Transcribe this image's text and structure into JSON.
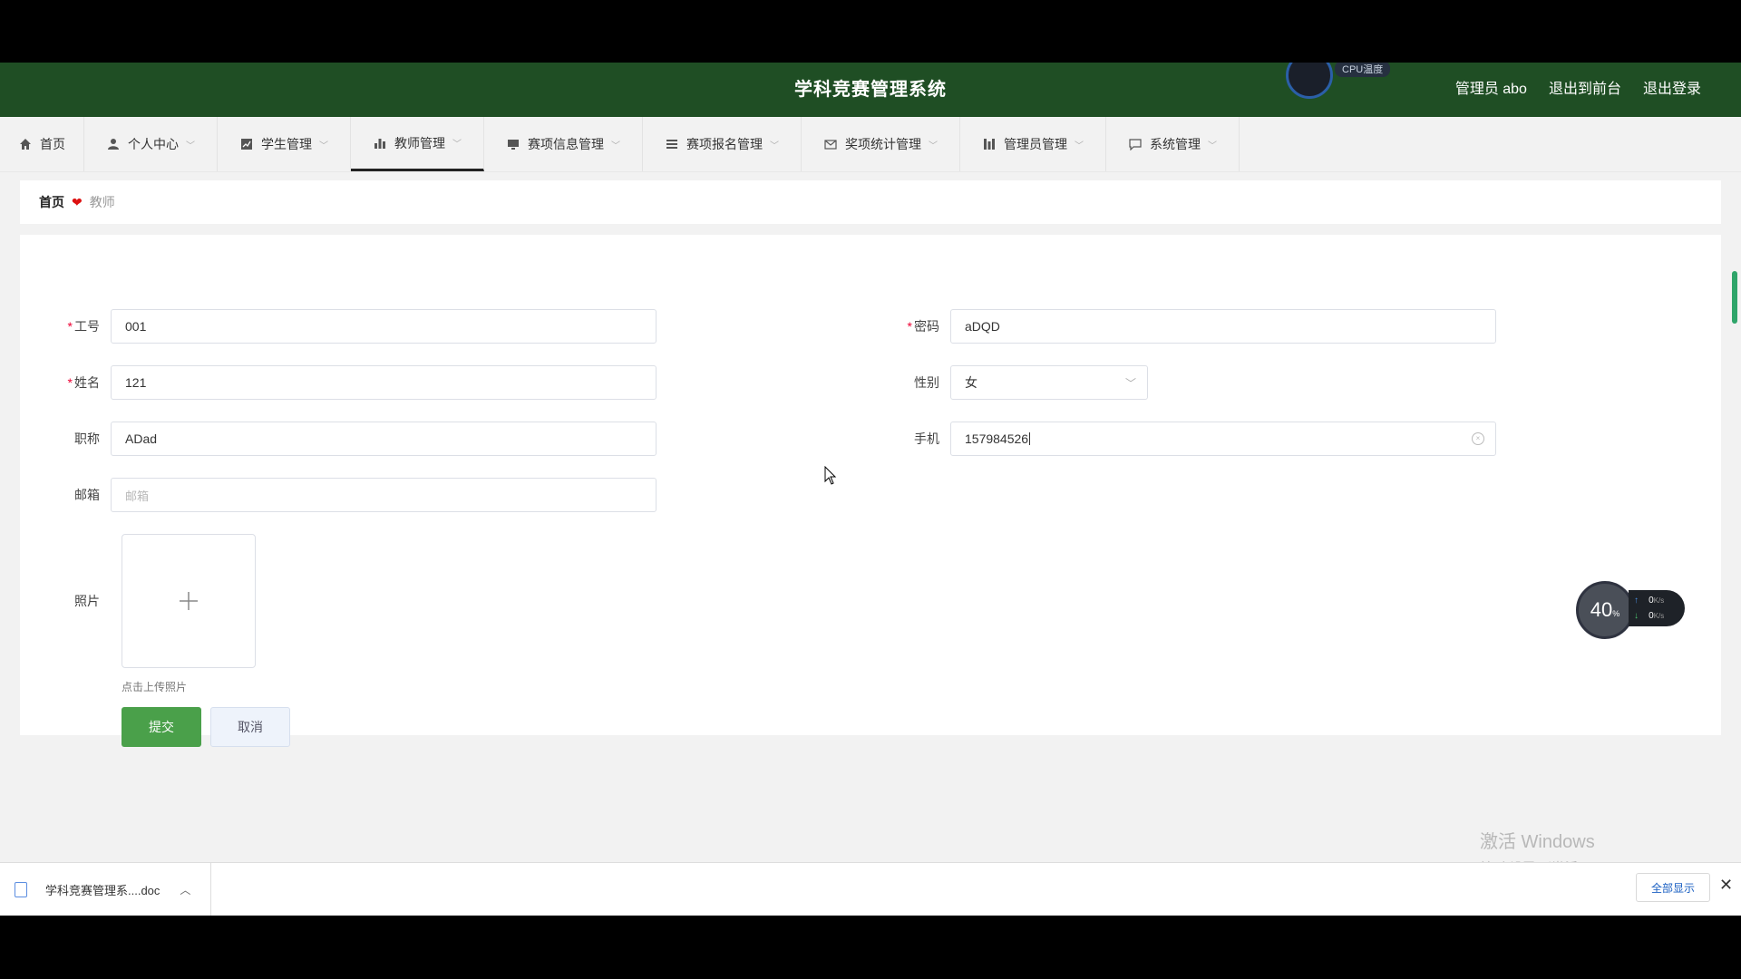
{
  "header": {
    "title": "学科竞赛管理系统",
    "cpu_label": "CPU温度",
    "admin_label": "管理员 abo",
    "to_frontend": "退出到前台",
    "logout": "退出登录",
    "bg_color": "#1f4e24"
  },
  "nav": [
    {
      "label": "首页",
      "icon": "home-icon"
    },
    {
      "label": "个人中心",
      "icon": "user-icon"
    },
    {
      "label": "学生管理",
      "icon": "chart-line-icon"
    },
    {
      "label": "教师管理",
      "icon": "bar-chart-icon",
      "active": true
    },
    {
      "label": "赛项信息管理",
      "icon": "monitor-icon"
    },
    {
      "label": "赛项报名管理",
      "icon": "list-icon"
    },
    {
      "label": "奖项统计管理",
      "icon": "mail-icon"
    },
    {
      "label": "管理员管理",
      "icon": "columns-icon"
    },
    {
      "label": "系统管理",
      "icon": "chat-icon"
    }
  ],
  "breadcrumb": {
    "home": "首页",
    "current": "教师"
  },
  "form": {
    "gonghao": {
      "label": "工号",
      "value": "001"
    },
    "mima": {
      "label": "密码",
      "value": "aDQD"
    },
    "xingming": {
      "label": "姓名",
      "value": "121"
    },
    "xingbie": {
      "label": "性别",
      "value": "女"
    },
    "zhicheng": {
      "label": "职称",
      "value": "ADad"
    },
    "shouji": {
      "label": "手机",
      "value": "157984526"
    },
    "youxiang": {
      "label": "邮箱",
      "placeholder": "邮箱"
    },
    "zhaopian": {
      "label": "照片",
      "hint": "点击上传照片"
    },
    "submit": "提交",
    "cancel": "取消"
  },
  "net_widget": {
    "percent": "40",
    "unit": "%",
    "up": "0",
    "down": "0",
    "rate_unit": "K/s"
  },
  "watermark": {
    "line1": "激活 Windows",
    "line2": "转到\"设置\"以激活 Windows。"
  },
  "download_bar": {
    "file": "学科竞赛管理系....doc",
    "show_all": "全部显示"
  }
}
